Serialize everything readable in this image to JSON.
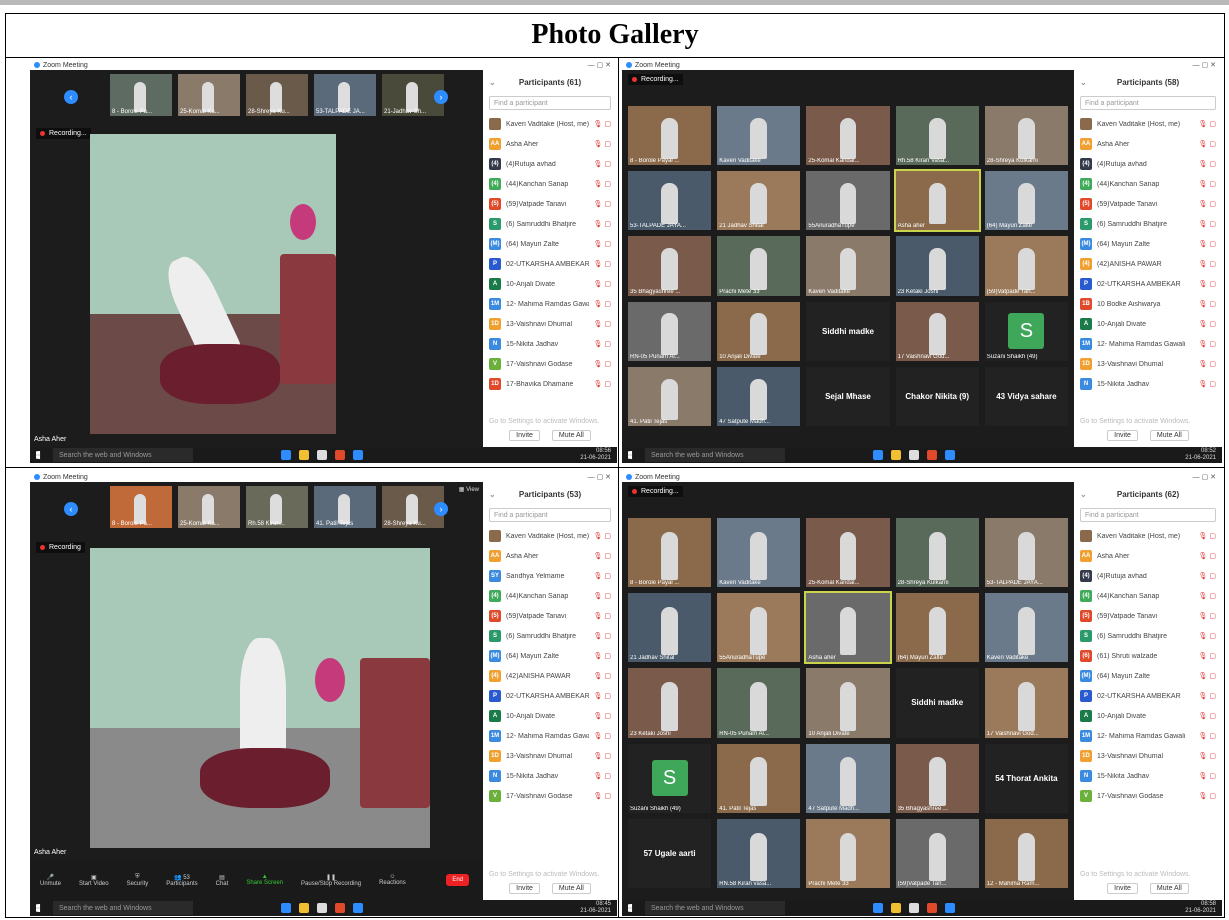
{
  "page": {
    "heading": "Photo Gallery"
  },
  "screenshots": [
    {
      "app_title": "Zoom Meeting",
      "recording": "Recording...",
      "active_speaker": "Asha Aher",
      "thumbnails": [
        "8 - Borole Pa...",
        "25-Komal Ka...",
        "28-Shreya Ku...",
        "53-TALPADE JA...",
        "21-Jadhav Sh..."
      ],
      "participants_title": "Participants (61)",
      "find_placeholder": "Find a participant",
      "participants": [
        {
          "initials": "",
          "name": "Kaveri Vaditake (Host, me)",
          "color": "#8a6a4a"
        },
        {
          "initials": "AA",
          "name": "Asha Aher",
          "color": "#f0a030"
        },
        {
          "initials": "(4)",
          "name": "(4)Rutuja avhad",
          "color": "#333a4a"
        },
        {
          "initials": "(4)",
          "name": "(44)Kanchan Sanap",
          "color": "#3faa5a"
        },
        {
          "initials": "(5)",
          "name": "(59)Vatpade Tanavi",
          "color": "#e04a2a"
        },
        {
          "initials": "S",
          "name": "(6) Samruddhi Bhatjire",
          "color": "#2a9a6a"
        },
        {
          "initials": "(M)",
          "name": "(64) Mayuri Zalte",
          "color": "#3a8ae0"
        },
        {
          "initials": "P",
          "name": "02-UTKARSHA AMBEKAR",
          "color": "#2a5ad0"
        },
        {
          "initials": "A",
          "name": "10-Anjali Divate",
          "color": "#1a7a4a"
        },
        {
          "initials": "1M",
          "name": "12- Mahima Ramdas Gawali",
          "color": "#3a8ae0"
        },
        {
          "initials": "1D",
          "name": "13-Vaishnavi Dhumal",
          "color": "#f0a030"
        },
        {
          "initials": "N",
          "name": "15-Nikita Jadhav",
          "color": "#3a8ae0"
        },
        {
          "initials": "V",
          "name": "17-Vaishnavi Godase",
          "color": "#6ab03a"
        },
        {
          "initials": "1D",
          "name": "17-Bhavika Dhamane",
          "color": "#e04a2a"
        }
      ],
      "activate": "Go to Settings to activate Windows.",
      "invite": "Invite",
      "mute_all": "Mute All",
      "taskbar_search": "Search the web and Windows",
      "time": "08:56",
      "date": "21-06-2021"
    },
    {
      "app_title": "Zoom Meeting",
      "recording": "Recording...",
      "participants_title": "Participants (58)",
      "find_placeholder": "Find a participant",
      "tiles": [
        {
          "label": "8 - Borole Payal ...",
          "kind": "video"
        },
        {
          "label": "Kaveri Vaditake",
          "kind": "video"
        },
        {
          "label": "25-Komal Kandal...",
          "kind": "video"
        },
        {
          "label": "Rh.58 Kiran Vasa...",
          "kind": "video"
        },
        {
          "label": "28-Shreya Kulkarni",
          "kind": "video"
        },
        {
          "label": "53-TALPADE JAYA...",
          "kind": "video"
        },
        {
          "label": "21 Jadhav Shital",
          "kind": "video"
        },
        {
          "label": "55AnuradhaTupe",
          "kind": "video"
        },
        {
          "label": "Asha aher",
          "kind": "active"
        },
        {
          "label": "(64) Mayuri Zalte",
          "kind": "video"
        },
        {
          "label": "35 Bhagyashree ...",
          "kind": "video"
        },
        {
          "label": "Prachi Mete 33",
          "kind": "video"
        },
        {
          "label": "Kaveri Vaditake",
          "kind": "video"
        },
        {
          "label": "23 Ketaki Joshi",
          "kind": "video"
        },
        {
          "label": "(59)Vatpade Tan...",
          "kind": "video"
        },
        {
          "label": "RN-05 Punam Al...",
          "kind": "video"
        },
        {
          "label": "10 Anjali Divate",
          "kind": "video"
        },
        {
          "label": "Siddhi madke",
          "kind": "text"
        },
        {
          "label": "17 Vaishnavi God...",
          "kind": "video"
        },
        {
          "label": "Suzani Shaikh (49)",
          "kind": "letter",
          "letter": "S"
        },
        {
          "label": "41. Patil Tejas",
          "kind": "video"
        },
        {
          "label": "47 Satpute Madh...",
          "kind": "video"
        },
        {
          "label": "Sejal Mhase",
          "kind": "text"
        },
        {
          "label": "Chakor Nikita (9)",
          "kind": "text"
        },
        {
          "label": "43 Vidya sahare",
          "kind": "text"
        }
      ],
      "participants": [
        {
          "initials": "",
          "name": "Kaveri Vaditake (Host, me)",
          "color": "#8a6a4a"
        },
        {
          "initials": "AA",
          "name": "Asha Aher",
          "color": "#f0a030"
        },
        {
          "initials": "(4)",
          "name": "(4)Rutuja avhad",
          "color": "#333a4a"
        },
        {
          "initials": "(4)",
          "name": "(44)Kanchan Sanap",
          "color": "#3faa5a"
        },
        {
          "initials": "(5)",
          "name": "(59)Vatpade Tanavi",
          "color": "#e04a2a"
        },
        {
          "initials": "S",
          "name": "(6) Samruddhi Bhatjire",
          "color": "#2a9a6a"
        },
        {
          "initials": "(M)",
          "name": "(64) Mayuri Zalte",
          "color": "#3a8ae0"
        },
        {
          "initials": "(4)",
          "name": "(42)ANISHA PAWAR",
          "color": "#f0a030"
        },
        {
          "initials": "P",
          "name": "02-UTKARSHA AMBEKAR",
          "color": "#2a5ad0"
        },
        {
          "initials": "1B",
          "name": "10 Bodke Aishwarya",
          "color": "#e04a2a"
        },
        {
          "initials": "A",
          "name": "10-Anjali Divate",
          "color": "#1a7a4a"
        },
        {
          "initials": "1M",
          "name": "12- Mahima Ramdas Gawali",
          "color": "#3a8ae0"
        },
        {
          "initials": "1D",
          "name": "13-Vaishnavi Dhumal",
          "color": "#f0a030"
        },
        {
          "initials": "N",
          "name": "15-Nikita Jadhav",
          "color": "#3a8ae0"
        }
      ],
      "activate": "Go to Settings to activate Windows.",
      "invite": "Invite",
      "mute_all": "Mute All",
      "taskbar_search": "Search the web and Windows",
      "time": "08:52",
      "date": "21-06-2021"
    },
    {
      "app_title": "Zoom Meeting",
      "recording": "Recording",
      "active_speaker": "Asha Aher",
      "view_label": "View",
      "thumbnails": [
        "8 - Borole Pa...",
        "25-Komal Ka...",
        "Rh.58 Kiran...",
        "41. Patil Tejas",
        "28-Shreya Ku..."
      ],
      "participants_title": "Participants (53)",
      "find_placeholder": "Find a participant",
      "participants": [
        {
          "initials": "",
          "name": "Kaveri Vaditake (Host, me)",
          "color": "#8a6a4a"
        },
        {
          "initials": "AA",
          "name": "Asha Aher",
          "color": "#f0a030"
        },
        {
          "initials": "SY",
          "name": "Sandhya Yelmame",
          "color": "#3a8ae0"
        },
        {
          "initials": "(4)",
          "name": "(44)Kanchan Sanap",
          "color": "#3faa5a"
        },
        {
          "initials": "(5)",
          "name": "(59)Vatpade Tanavi",
          "color": "#e04a2a"
        },
        {
          "initials": "S",
          "name": "(6) Samruddhi Bhatjire",
          "color": "#2a9a6a"
        },
        {
          "initials": "(M)",
          "name": "(64) Mayuri Zalte",
          "color": "#3a8ae0"
        },
        {
          "initials": "(4)",
          "name": "(42)ANISHA PAWAR",
          "color": "#f0a030"
        },
        {
          "initials": "P",
          "name": "02-UTKARSHA AMBEKAR",
          "color": "#2a5ad0"
        },
        {
          "initials": "A",
          "name": "10-Anjali Divate",
          "color": "#1a7a4a"
        },
        {
          "initials": "1M",
          "name": "12- Mahima Ramdas Gawali",
          "color": "#3a8ae0"
        },
        {
          "initials": "1D",
          "name": "13-Vaishnavi Dhumal",
          "color": "#f0a030"
        },
        {
          "initials": "N",
          "name": "15-Nikita Jadhav",
          "color": "#3a8ae0"
        },
        {
          "initials": "V",
          "name": "17-Vaishnavi Godase",
          "color": "#6ab03a"
        }
      ],
      "controls": [
        "Unmute",
        "Start Video",
        "Security",
        "Participants",
        "Chat",
        "Share Screen",
        "Pause/Stop Recording",
        "Reactions"
      ],
      "participants_count": "53",
      "end_label": "End",
      "activate": "Go to Settings to activate Windows.",
      "invite": "Invite",
      "mute_all": "Mute All",
      "taskbar_search": "Search the web and Windows",
      "time": "08:45",
      "date": "21-06-2021"
    },
    {
      "app_title": "Zoom Meeting",
      "recording": "Recording...",
      "participants_title": "Participants (62)",
      "find_placeholder": "Find a participant",
      "tiles": [
        {
          "label": "8 - Borole Payal ...",
          "kind": "video"
        },
        {
          "label": "Kaveri Vaditake",
          "kind": "video"
        },
        {
          "label": "25-Komal Kandal...",
          "kind": "video"
        },
        {
          "label": "28-Shreya Kulkarni",
          "kind": "video"
        },
        {
          "label": "53-TALPADE JAYA...",
          "kind": "video"
        },
        {
          "label": "21 Jadhav Shital",
          "kind": "video"
        },
        {
          "label": "55AnuradhaTupe",
          "kind": "video"
        },
        {
          "label": "Asha aher",
          "kind": "active"
        },
        {
          "label": "(64) Mayuri Zalte",
          "kind": "video"
        },
        {
          "label": "Kaveri Vaditake",
          "kind": "video"
        },
        {
          "label": "23 Ketaki Joshi",
          "kind": "video"
        },
        {
          "label": "RN-05 Punam Al...",
          "kind": "video"
        },
        {
          "label": "10 Anjali Divate",
          "kind": "video"
        },
        {
          "label": "Siddhi madke",
          "kind": "text"
        },
        {
          "label": "17 Vaishnavi God...",
          "kind": "video"
        },
        {
          "label": "Suzani Shaikh (49)",
          "kind": "letter",
          "letter": "S"
        },
        {
          "label": "41. Patil Tejas",
          "kind": "video"
        },
        {
          "label": "47 Satpute Madh...",
          "kind": "video"
        },
        {
          "label": "35 Bhagyashree ...",
          "kind": "video"
        },
        {
          "label": "54 Thorat Ankita",
          "kind": "text"
        },
        {
          "label": "57 Ugale aarti",
          "kind": "text"
        },
        {
          "label": "RN.58 Kiran vasa...",
          "kind": "video"
        },
        {
          "label": "Prachi Mete 33",
          "kind": "video"
        },
        {
          "label": "(59)Vatpade Tan...",
          "kind": "video"
        },
        {
          "label": "12 - Mahima Ram...",
          "kind": "video"
        }
      ],
      "participants": [
        {
          "initials": "",
          "name": "Kaveri Vaditake (Host, me)",
          "color": "#8a6a4a"
        },
        {
          "initials": "AA",
          "name": "Asha Aher",
          "color": "#f0a030"
        },
        {
          "initials": "(4)",
          "name": "(4)Rutuja avhad",
          "color": "#333a4a"
        },
        {
          "initials": "(4)",
          "name": "(44)Kanchan Sanap",
          "color": "#3faa5a"
        },
        {
          "initials": "(5)",
          "name": "(59)Vatpade Tanavi",
          "color": "#e04a2a"
        },
        {
          "initials": "S",
          "name": "(6) Samruddhi Bhatjire",
          "color": "#2a9a6a"
        },
        {
          "initials": "(6)",
          "name": "(61) Shruti walzade",
          "color": "#e04a2a"
        },
        {
          "initials": "(M)",
          "name": "(64) Mayuri Zalte",
          "color": "#3a8ae0"
        },
        {
          "initials": "P",
          "name": "02-UTKARSHA AMBEKAR",
          "color": "#2a5ad0"
        },
        {
          "initials": "A",
          "name": "10-Anjali Divate",
          "color": "#1a7a4a"
        },
        {
          "initials": "1M",
          "name": "12- Mahima Ramdas Gawali",
          "color": "#3a8ae0"
        },
        {
          "initials": "1D",
          "name": "13-Vaishnavi Dhumal",
          "color": "#f0a030"
        },
        {
          "initials": "N",
          "name": "15-Nikita Jadhav",
          "color": "#3a8ae0"
        },
        {
          "initials": "V",
          "name": "17-Vaishnavi Godase",
          "color": "#6ab03a"
        }
      ],
      "activate": "Go to Settings to activate Windows.",
      "invite": "Invite",
      "mute_all": "Mute All",
      "taskbar_search": "Search the web and Windows",
      "time": "08:58",
      "date": "21-06-2021"
    }
  ]
}
